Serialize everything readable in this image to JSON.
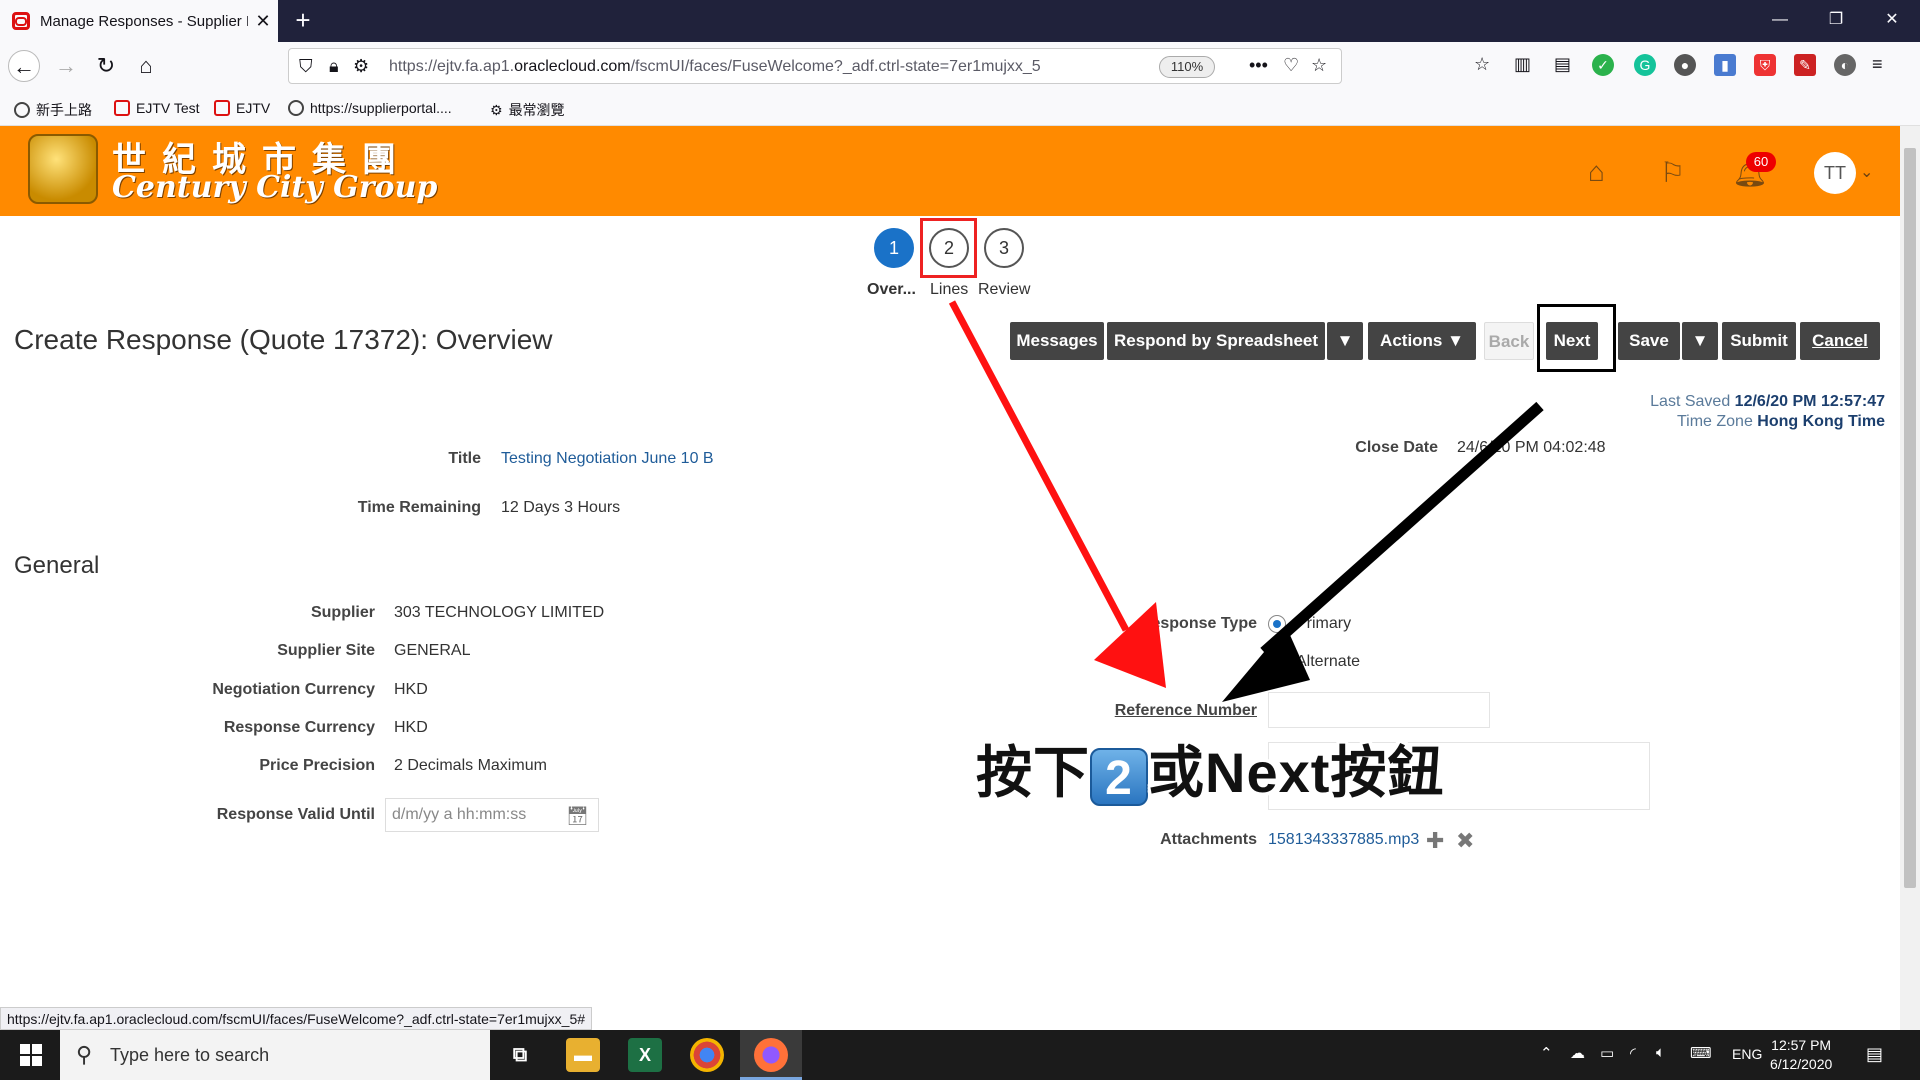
{
  "browser": {
    "tab_title": "Manage Responses - Supplier P",
    "url_prefix": "https://ejtv.fa.ap1.",
    "url_domain": "oraclecloud.com",
    "url_suffix": "/fscmUI/faces/FuseWelcome?_adf.ctrl-state=7er1mujxx_5",
    "zoom": "110%",
    "status_url": "https://ejtv.fa.ap1.oraclecloud.com/fscmUI/faces/FuseWelcome?_adf.ctrl-state=7er1mujxx_5#"
  },
  "bookmarks": [
    "新手上路",
    "EJTV Test",
    "EJTV",
    "https://supplierportal....",
    "最常瀏覽"
  ],
  "brand": {
    "name_cn": "世紀城市集團",
    "name_en": "Century City Group",
    "color": "#ff8a00"
  },
  "header": {
    "notification_count": "60",
    "user_initials": "TT"
  },
  "train": {
    "steps": [
      {
        "number": "1",
        "label": "Over..."
      },
      {
        "number": "2",
        "label": "Lines"
      },
      {
        "number": "3",
        "label": "Review"
      }
    ]
  },
  "page": {
    "title": "Create Response (Quote 17372): Overview"
  },
  "toolbar": {
    "messages": "Messages",
    "respond_by_spreadsheet": "Respond by Spreadsheet",
    "actions": "Actions",
    "back": "Back",
    "next": "Next",
    "save": "Save",
    "submit": "Submit",
    "cancel": "Cancel"
  },
  "save_info": {
    "last_saved_label": "Last Saved",
    "last_saved_value": "12/6/20 PM 12:57:47",
    "time_zone_label": "Time Zone",
    "time_zone_value": "Hong Kong Time"
  },
  "header_fields": {
    "title_label": "Title",
    "title_value": "Testing Negotiation June 10 B",
    "time_remaining_label": "Time Remaining",
    "time_remaining_value": "12 Days 3 Hours",
    "close_date_label": "Close Date",
    "close_date_value": "24/6/20 PM 04:02:48"
  },
  "general": {
    "heading": "General",
    "fields": [
      {
        "label": "Supplier",
        "value": "303 TECHNOLOGY LIMITED"
      },
      {
        "label": "Supplier Site",
        "value": "GENERAL"
      },
      {
        "label": "Negotiation Currency",
        "value": "HKD"
      },
      {
        "label": "Response Currency",
        "value": "HKD"
      },
      {
        "label": "Price Precision",
        "value": "2 Decimals Maximum"
      }
    ],
    "valid_until_label": "Response Valid Until",
    "valid_until_placeholder": "d/m/yy a hh:mm:ss"
  },
  "right_fields": {
    "response_type_label": "Response Type",
    "response_type_primary": "Primary",
    "response_type_alternate": "Alternate",
    "reference_number_label": "Reference Number",
    "attachments_label": "Attachments",
    "attachment_file": "1581343337885.mp3"
  },
  "annotation": {
    "text_before": "按下",
    "key": "2",
    "text_after": "或Next按鈕"
  },
  "taskbar": {
    "search_placeholder": "Type here to search",
    "language": "ENG",
    "time": "12:57 PM",
    "date": "6/12/2020"
  }
}
